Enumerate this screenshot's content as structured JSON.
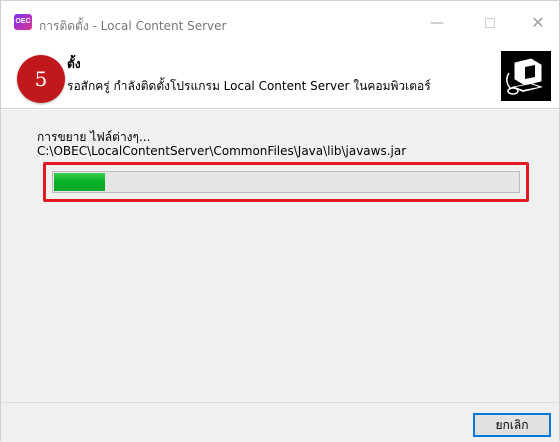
{
  "window": {
    "title": "การติดตั้ง - Local Content Server",
    "app_icon_text": "OEC",
    "controls": {
      "minimize_glyph": "—",
      "close_glyph": "✕"
    }
  },
  "header": {
    "step_number": "5",
    "title": "ตั้ง",
    "subtitle": "รอสักครู่ กำลังติดตั้งโปรแกรม Local Content Server ในคอมพิวเตอร์"
  },
  "body": {
    "status_text": "การขยาย ไฟล์ต่างๆ...",
    "current_file": "C:\\OBEC\\LocalContentServer\\CommonFiles\\Java\\lib\\javaws.jar",
    "progress": 0.11
  },
  "footer": {
    "cancel_label": "ยกเลิก"
  },
  "colors": {
    "highlight": "#e01b24",
    "badge": "#c0181c",
    "progress_fill": "#06b025"
  },
  "icons": {
    "app": "app-logo-icon",
    "header": "computer-install-icon"
  }
}
